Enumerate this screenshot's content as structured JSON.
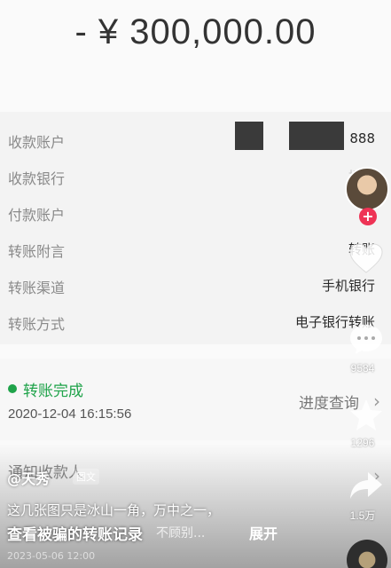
{
  "amount": "- ¥ 300,000.00",
  "details": [
    {
      "label": "收款账户",
      "value": "888"
    },
    {
      "label": "收款银行",
      "value": "招商"
    },
    {
      "label": "付款账户",
      "value": ""
    },
    {
      "label": "转账附言",
      "value": "转账"
    },
    {
      "label": "转账渠道",
      "value": "手机银行"
    },
    {
      "label": "转账方式",
      "value": "电子银行转账"
    }
  ],
  "status": {
    "text": "转账完成",
    "time": "2020-12-04 16:15:56",
    "progress_link": "进度查询",
    "color": "#1fa34a"
  },
  "notify_label": "通知收款人",
  "video": {
    "author": "@天秀",
    "author_tag": "图文",
    "caption_line1": "这几张图只是冰山一角，万中之一，",
    "caption_line2": "查看被骗的转账记录",
    "caption_more": "不顾别...",
    "expand_label": "展开",
    "footnote": "2023-05-06  12:00"
  },
  "sidebar": {
    "like_count": "",
    "comment_count": "9584",
    "favorite_count": "1296",
    "share_count": "1.5万",
    "follow_symbol": "+",
    "accent_color": "#ee3355"
  }
}
